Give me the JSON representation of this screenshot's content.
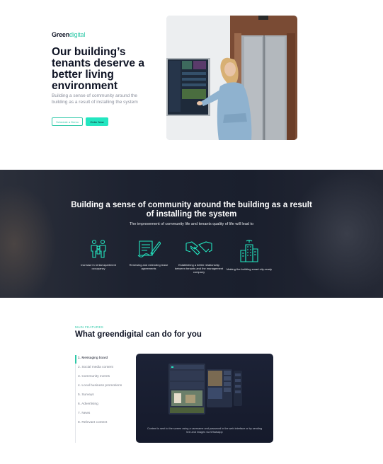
{
  "brand": {
    "name_part1": "Green",
    "name_part2": "digital"
  },
  "hero": {
    "title": "Our building’s tenants deserve a better living environment",
    "subtitle": "Building a sense of community around the building as a result of installing the system",
    "btn_outline": "Schedule a Demo",
    "btn_fill": "Order Now"
  },
  "band": {
    "title": "Building a sense of community around the building as a result of installing the system",
    "subtitle": "The improvement of community life and tenants quality of life will lead to",
    "features": [
      {
        "label": "Increase in rental apartment occupancy",
        "icon": "family-icon"
      },
      {
        "label": "Renewing and extending lease agreements",
        "icon": "contract-icon"
      },
      {
        "label": "Establishing a better relationship between tenants and the management company",
        "icon": "handshake-icon"
      },
      {
        "label": "Making the building smart city-ready",
        "icon": "smart-building-icon"
      }
    ]
  },
  "features_section": {
    "eyebrow": "MAIN FEATURES",
    "title": "What greendigital can do for you",
    "menu": [
      "1. Messaging board",
      "2. Social media content",
      "3. Community events",
      "4. Local business promotions",
      "5. Surveys",
      "6. Advertising",
      "7. News",
      "8. Relevant content"
    ],
    "active_index": 0,
    "caption": "Content is sent to the screen using a username and password in the web interface or by sending text and images via WhatsApp"
  },
  "colors": {
    "accent": "#23e6c0",
    "dark": "#0e1324",
    "band": "#1d2230"
  }
}
